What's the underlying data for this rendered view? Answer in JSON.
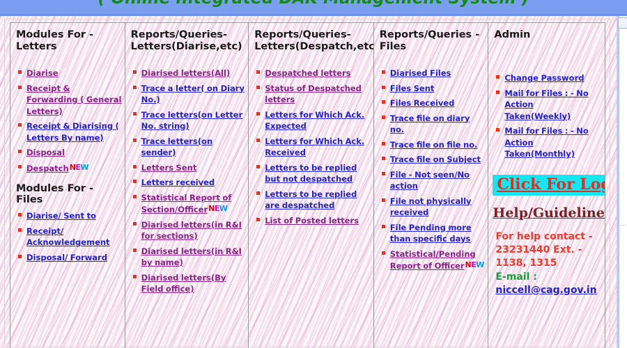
{
  "banner": {
    "title": "( Online Integrated DAK Management System )",
    "bg_color": "#7b9ff0",
    "text_color": "#128a14"
  },
  "colors": {
    "link_blue": "#2222cc",
    "link_purple": "#8b1f8b",
    "bullet_red": "#e8301b",
    "login_highlight": "#15e6f2",
    "login_text": "#e03020",
    "help_text": "#7a2020",
    "contact_text": "#f03a28",
    "email_label": "#1f9b3c",
    "page_bg": "#fdf6fa"
  },
  "new_badge": {
    "label": "NEW",
    "n": "N",
    "e": "E",
    "w": "W"
  },
  "columns": [
    {
      "id": "modules-letters",
      "header": "Modules For - Letters",
      "header_line1": "Modules For -",
      "header_line2": "Letters",
      "links": [
        {
          "label": "Diarise",
          "state": "visited"
        },
        {
          "label": "Receipt & Forwarding ( General Letters)",
          "state": "visited"
        },
        {
          "label": "Receipt & Diarising ( Letters By name)",
          "state": "unvisited"
        },
        {
          "label": "Disposal",
          "state": "visited"
        },
        {
          "label": "Despatch",
          "state": "visited",
          "badge": "NEW"
        }
      ],
      "subhead": "Modules For - Files",
      "sub_links": [
        {
          "label": "Diarise/ Sent to",
          "state": "unvisited"
        },
        {
          "label": "Receipt/ Acknowledgement",
          "state": "unvisited"
        },
        {
          "label": "Disposal/ Forward",
          "state": "unvisited"
        }
      ]
    },
    {
      "id": "reports-letters-diarise",
      "header": "Reports/Queries-Letters(Diarise,etc)",
      "header_line1": "Reports/Queries-",
      "header_line2": "Letters(Diarise,etc)",
      "links": [
        {
          "label": "Diarised letters(All)",
          "state": "visited"
        },
        {
          "label": "Trace a letter( on Diary No.)",
          "state": "unvisited"
        },
        {
          "label": "Trace letters(on Letter No. string)",
          "state": "unvisited"
        },
        {
          "label": "Trace letters(on sender)",
          "state": "unvisited"
        },
        {
          "label": "Letters Sent",
          "state": "visited"
        },
        {
          "label": "Letters received",
          "state": "unvisited"
        },
        {
          "label": "Statistical Report of Section/Officer",
          "state": "visited",
          "badge": "NEW"
        },
        {
          "label": "Diarised letters(in R&I for sections)",
          "state": "visited"
        },
        {
          "label": "Diarised letters(in R&I by name)",
          "state": "visited"
        },
        {
          "label": "Diarised letters(By Field office)",
          "state": "visited"
        }
      ]
    },
    {
      "id": "reports-letters-despatch",
      "header": "Reports/Queries-Letters(Despatch,etc)",
      "header_line1": "Reports/Queries-",
      "header_line2": "Letters(Despatch,etc)",
      "links": [
        {
          "label": "Despatched letters",
          "state": "visited"
        },
        {
          "label": "Status of Despatched letters",
          "state": "visited"
        },
        {
          "label": "Letters for Which Ack. Expected",
          "state": "unvisited"
        },
        {
          "label": "Letters for Which Ack. Received",
          "state": "unvisited"
        },
        {
          "label": "Letters to be replied but not despatched",
          "state": "unvisited"
        },
        {
          "label": "Letters to be replied are despatched",
          "state": "unvisited"
        },
        {
          "label": "List of Posted letters",
          "state": "visited"
        }
      ]
    },
    {
      "id": "reports-files",
      "header": "Reports/Queries - Files",
      "header_line1": "Reports/Queries -",
      "header_line2": "Files",
      "links": [
        {
          "label": "Diarised Files",
          "state": "unvisited"
        },
        {
          "label": "Files Sent",
          "state": "unvisited"
        },
        {
          "label": "Files Received",
          "state": "unvisited"
        },
        {
          "label": "Trace file on diary no.",
          "state": "unvisited"
        },
        {
          "label": "Trace file on file no.",
          "state": "unvisited"
        },
        {
          "label": "Trace file on Subject",
          "state": "unvisited"
        },
        {
          "label": "File - Not seen/No action",
          "state": "unvisited"
        },
        {
          "label": "File not physically received",
          "state": "unvisited"
        },
        {
          "label": "File Pending more than specific days",
          "state": "unvisited"
        },
        {
          "label": "Statistical/Pending Report of Officer",
          "state": "visited",
          "badge": "NEW"
        }
      ]
    },
    {
      "id": "admin",
      "header": "Admin",
      "header_line1": "Admin",
      "header_line2": "",
      "links": [
        {
          "label": "Change Password",
          "state": "unvisited"
        },
        {
          "label": "Mail for Files : - No Action Taken(Weekly)",
          "state": "unvisited"
        },
        {
          "label": "Mail for Files : - No Action Taken(Monthly)",
          "state": "unvisited"
        }
      ],
      "login_label": "Click For Login",
      "help_label": "Help/Guidelines",
      "contact_line1": "For help contact -",
      "contact_line2": "23231440 Ext. -",
      "contact_line3": "1138, 1315",
      "email_label": "E-mail :",
      "email_address": "niccell@cag.gov.in"
    }
  ]
}
